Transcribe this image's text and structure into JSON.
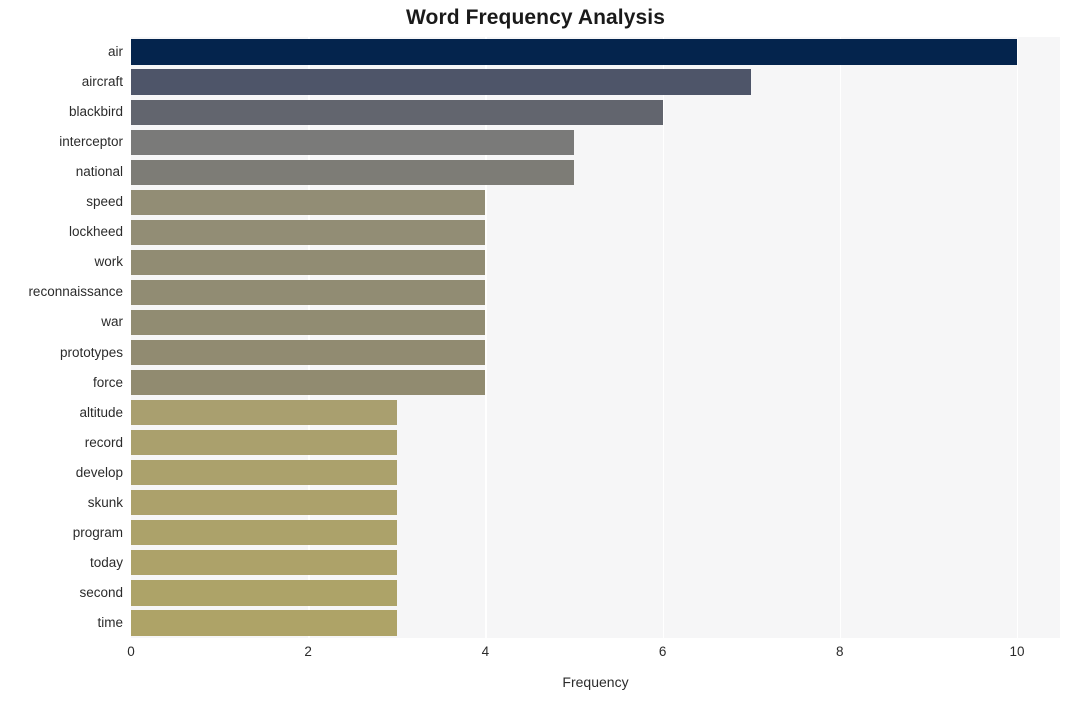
{
  "chart_data": {
    "type": "bar",
    "orientation": "horizontal",
    "title": "Word Frequency Analysis",
    "xlabel": "Frequency",
    "ylabel": "",
    "xlim": [
      0,
      10
    ],
    "xticks": [
      0,
      2,
      4,
      6,
      8,
      10
    ],
    "xtick_labels": [
      "0",
      "2",
      "4",
      "6",
      "8",
      "10"
    ],
    "grid": "vertical-white",
    "legend": "none",
    "categories": [
      "air",
      "aircraft",
      "blackbird",
      "interceptor",
      "national",
      "speed",
      "lockheed",
      "work",
      "reconnaissance",
      "war",
      "prototypes",
      "force",
      "altitude",
      "record",
      "develop",
      "skunk",
      "program",
      "today",
      "second",
      "time"
    ],
    "values": [
      10,
      7,
      6,
      5,
      5,
      4,
      4,
      4,
      4,
      4,
      4,
      4,
      3,
      3,
      3,
      3,
      3,
      3,
      3,
      3
    ],
    "bar_colors": [
      "#04244d",
      "#4e5569",
      "#62656e",
      "#7a7a79",
      "#7d7c76",
      "#928d75",
      "#928d75",
      "#918c73",
      "#918c73",
      "#918c72",
      "#918b71",
      "#918b70",
      "#a99f6f",
      "#aaa06d",
      "#aba16c",
      "#aca16b",
      "#aca26a",
      "#ada269",
      "#ada368",
      "#aea367"
    ],
    "plot_background": "#f6f6f7",
    "figure_background": "#ffffff",
    "gridline_color": "#ffffff",
    "text_color": "#2b2b2b"
  }
}
